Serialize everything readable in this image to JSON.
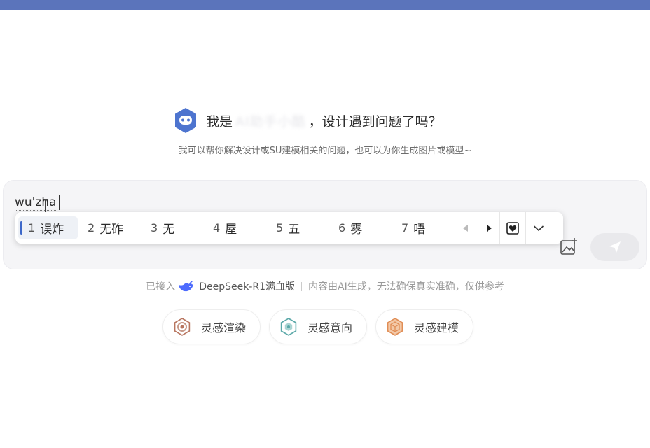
{
  "hero": {
    "prefix": "我是",
    "assistant_name": "AI助手小酷",
    "suffix": "，设计遇到问题了吗？"
  },
  "subtitle": "我可以帮你解决设计或SU建模相关的问题，也可以为你生成图片或模型~",
  "input": {
    "composition_text": "wu'zha"
  },
  "ime": {
    "candidates": [
      {
        "num": "1",
        "text": "误炸",
        "selected": true
      },
      {
        "num": "2",
        "text": "无砟"
      },
      {
        "num": "3",
        "text": "无"
      },
      {
        "num": "4",
        "text": "屋"
      },
      {
        "num": "5",
        "text": "五"
      },
      {
        "num": "6",
        "text": "雾"
      },
      {
        "num": "7",
        "text": "唔"
      }
    ]
  },
  "footer": {
    "connected_label": "已接入",
    "model_name": "DeepSeek-R1满血版",
    "disclaimer": "内容由AI生成，无法确保真实准确，仅供参考"
  },
  "actions": [
    {
      "label": "灵感渲染",
      "color": "#b8755f"
    },
    {
      "label": "灵感意向",
      "color": "#5aa8a8"
    },
    {
      "label": "灵感建模",
      "color": "#e08d55"
    }
  ],
  "colors": {
    "top_bar": "#5b74bb",
    "logo": "#4d74cf",
    "accent": "#3d68c9",
    "whale": "#4d6bfe"
  }
}
